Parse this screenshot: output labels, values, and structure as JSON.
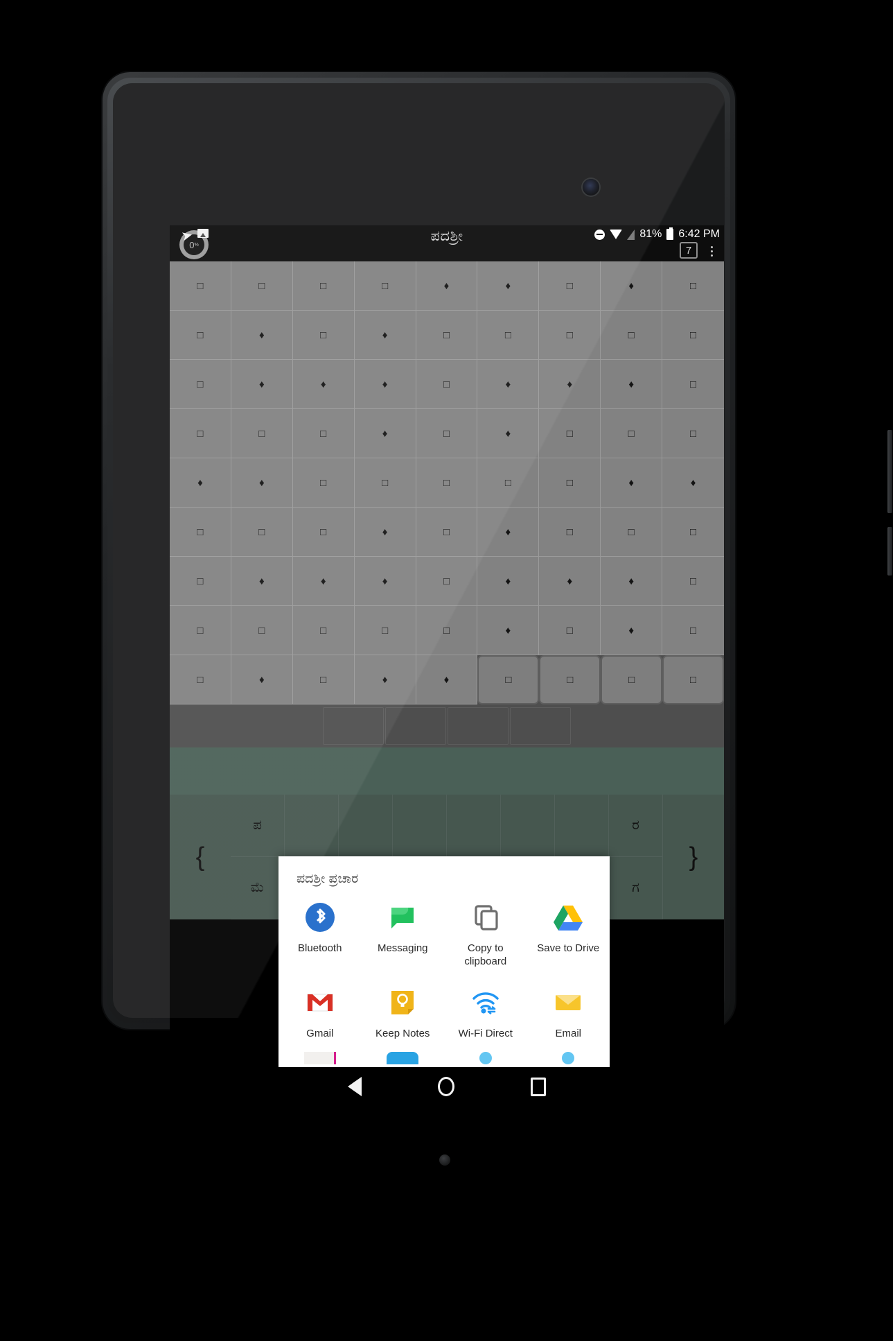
{
  "app": {
    "title": "ಪದಶ್ರೀ"
  },
  "statusbar": {
    "upload_percent": "0",
    "percent_symbol": "%",
    "plane_icon": "send-icon",
    "image_icon": "image-icon",
    "dnd_icon": "do-not-disturb-icon",
    "wifi_icon": "wifi-icon",
    "signal_icon": "signal-icon",
    "battery_percent": "81%",
    "battery_icon": "battery-icon",
    "time": "6:42 PM",
    "tab_count": "7",
    "overflow_icon": "overflow-menu-icon"
  },
  "board": {
    "rows": [
      [
        "square",
        "square",
        "square",
        "square",
        "diamond",
        "diamond",
        "square",
        "diamond",
        "square"
      ],
      [
        "square",
        "diamond",
        "square",
        "diamond",
        "square",
        "square",
        "square",
        "square",
        "square"
      ],
      [
        "square",
        "diamond",
        "diamond",
        "diamond",
        "square",
        "diamond",
        "diamond",
        "diamond",
        "square"
      ],
      [
        "square",
        "square",
        "square",
        "diamond",
        "square",
        "diamond",
        "square",
        "square",
        "square"
      ],
      [
        "diamond",
        "diamond",
        "square",
        "square",
        "square",
        "square",
        "square",
        "diamond",
        "diamond"
      ],
      [
        "square",
        "square",
        "square",
        "diamond",
        "square",
        "diamond",
        "square",
        "square",
        "square"
      ],
      [
        "square",
        "diamond",
        "diamond",
        "diamond",
        "square",
        "diamond",
        "diamond",
        "diamond",
        "square"
      ],
      [
        "square",
        "square",
        "square",
        "square",
        "square",
        "diamond",
        "square",
        "diamond",
        "square"
      ],
      [
        "square",
        "diamond",
        "square",
        "diamond",
        "diamond",
        "square",
        "square",
        "square",
        "square"
      ]
    ],
    "selected_cells": [
      [
        8,
        5
      ],
      [
        8,
        6
      ],
      [
        8,
        7
      ],
      [
        8,
        8
      ]
    ],
    "glyphs": {
      "square": "□",
      "diamond": "♦"
    }
  },
  "keyboard": {
    "left_key": "{",
    "right_key": "}",
    "keys_row1": [
      "ಪ",
      "",
      "",
      "",
      "",
      "",
      "",
      "ರ"
    ],
    "keys_row2": [
      "ಮೆ",
      "",
      "",
      "",
      "",
      "",
      "",
      "ಗ"
    ]
  },
  "dialog": {
    "title": "ಪದಶ್ರೀ ಪ್ರಚಾರ",
    "items": [
      {
        "label": "Bluetooth",
        "icon": "bluetooth-icon",
        "color": "#2a71cc"
      },
      {
        "label": "Messaging",
        "icon": "messaging-icon",
        "color": "#22c15e"
      },
      {
        "label": "Copy to clipboard",
        "icon": "copy-to-clipboard-icon",
        "color": "#6e6e6e"
      },
      {
        "label": "Save to Drive",
        "icon": "google-drive-icon",
        "color": "#ffc107"
      },
      {
        "label": "Gmail",
        "icon": "gmail-icon",
        "color": "#d93025"
      },
      {
        "label": "Keep Notes",
        "icon": "google-keep-icon",
        "color": "#f0b419"
      },
      {
        "label": "Wi-Fi Direct",
        "icon": "wifi-direct-icon",
        "color": "#2196f3"
      },
      {
        "label": "Email",
        "icon": "email-icon",
        "color": "#f7c52b"
      }
    ]
  },
  "navbar": {
    "back": "back-icon",
    "home": "home-icon",
    "recents": "recents-icon"
  }
}
